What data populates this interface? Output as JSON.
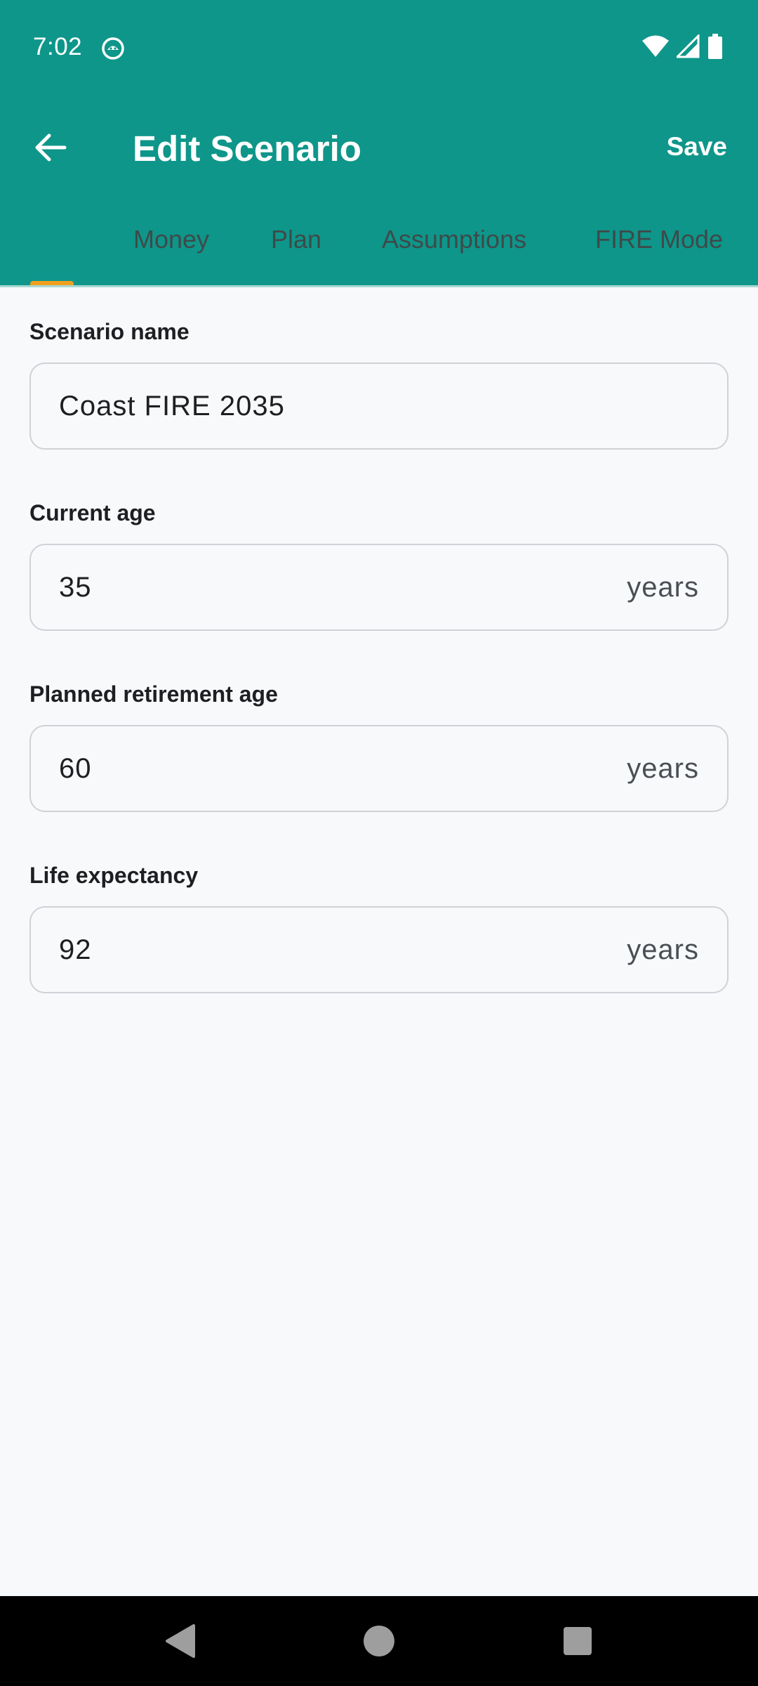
{
  "status_bar": {
    "time": "7:02",
    "icons": [
      "notification-app-icon",
      "wifi-icon",
      "signal-icon",
      "battery-icon"
    ]
  },
  "app_bar": {
    "title": "Edit Scenario",
    "save_label": "Save",
    "back_icon": "arrow-left-icon"
  },
  "tabs": [
    {
      "label": ""
    },
    {
      "label": "Money"
    },
    {
      "label": "Plan"
    },
    {
      "label": "Assumptions"
    },
    {
      "label": "FIRE Mode"
    }
  ],
  "fields": {
    "scenario_name": {
      "label": "Scenario name",
      "value": "Coast FIRE 2035"
    },
    "current_age": {
      "label": "Current age",
      "value": "35",
      "suffix": "years"
    },
    "retirement_age": {
      "label": "Planned retirement age",
      "value": "60",
      "suffix": "years"
    },
    "life_expectancy": {
      "label": "Life expectancy",
      "value": "92",
      "suffix": "years"
    }
  },
  "colors": {
    "header": "#0e968a",
    "tab_indicator": "#f0a020",
    "background": "#f8f9fb"
  },
  "nav_bar": {
    "icons": [
      "nav-back-icon",
      "nav-home-icon",
      "nav-recents-icon"
    ]
  }
}
